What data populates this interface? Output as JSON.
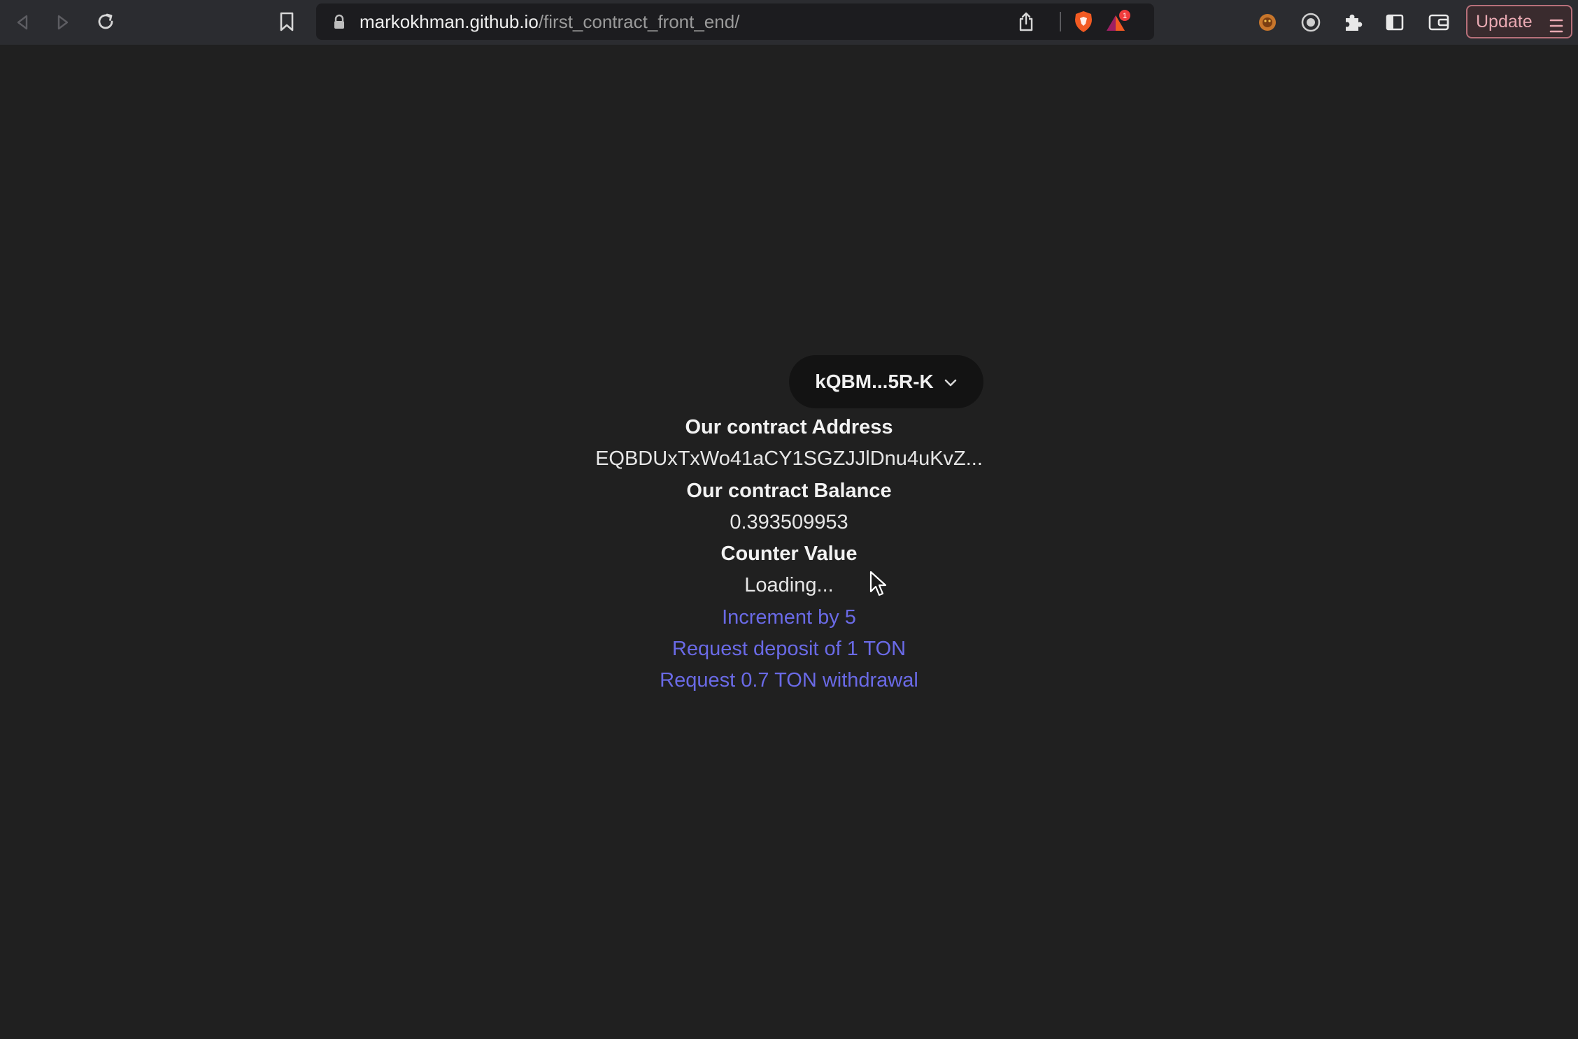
{
  "browser": {
    "url_host": "markokhman.github.io",
    "url_path": "/first_contract_front_end/",
    "update_label": "Update",
    "notification_count": "1"
  },
  "wallet": {
    "address_short": "kQBM...5R-K"
  },
  "contract": {
    "address_label": "Our contract Address",
    "address_value": "EQBDUxTxWo41aCY1SGZJJlDnu4uKvZ...",
    "balance_label": "Our contract Balance",
    "balance_value": "0.393509953",
    "counter_label": "Counter Value",
    "counter_value": "Loading..."
  },
  "actions": {
    "increment": "Increment by 5",
    "deposit": "Request deposit of 1 TON",
    "withdraw": "Request 0.7 TON withdrawal"
  },
  "colors": {
    "background": "#202020",
    "link": "#6a6ae6",
    "wallet_button": "#131313",
    "brave_orange": "#f25a22"
  }
}
